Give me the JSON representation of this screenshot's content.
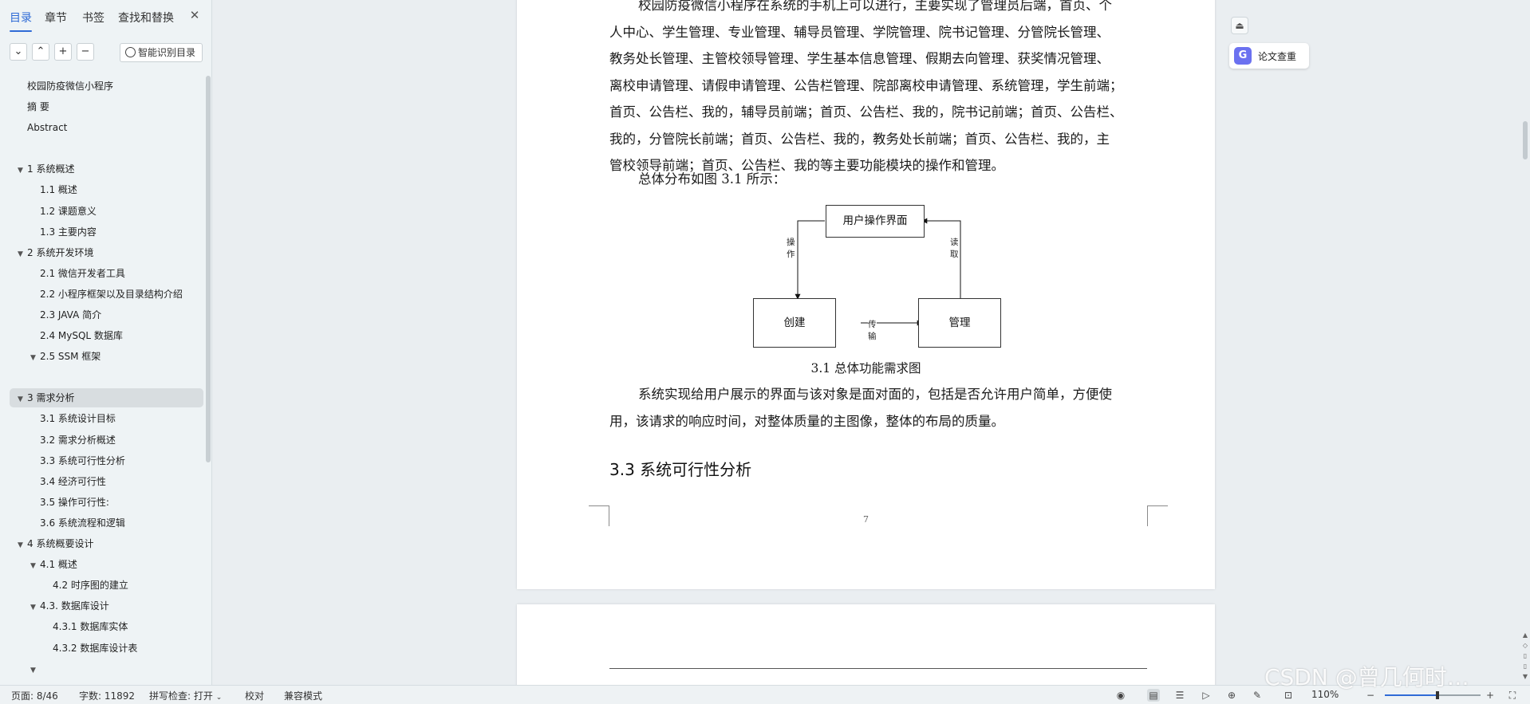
{
  "sidebar": {
    "tabs": [
      {
        "label": "目录",
        "active": true
      },
      {
        "label": "章节"
      },
      {
        "label": "书签"
      },
      {
        "label": "查找和替换"
      }
    ],
    "close_icon": "close-icon",
    "smart_toc_label": "智能识别目录",
    "toc": [
      {
        "label": "校园防疫微信小程序",
        "level": 0,
        "arrow": ""
      },
      {
        "label": "摘  要",
        "level": 0,
        "arrow": ""
      },
      {
        "label": "Abstract",
        "level": 0,
        "arrow": ""
      },
      {
        "label": "1  系统概述",
        "level": 0,
        "arrow": "▼"
      },
      {
        "label": "1.1  概述",
        "level": 1,
        "arrow": ""
      },
      {
        "label": "1.2 课题意义",
        "level": 1,
        "arrow": ""
      },
      {
        "label": "1.3  主要内容",
        "level": 1,
        "arrow": ""
      },
      {
        "label": "2  系统开发环境",
        "level": 0,
        "arrow": "▼"
      },
      {
        "label": "2.1 微信开发者工具",
        "level": 1,
        "arrow": ""
      },
      {
        "label": "2.2 小程序框架以及目录结构介绍",
        "level": 1,
        "arrow": ""
      },
      {
        "label": "2.3 JAVA 简介",
        "level": 1,
        "arrow": ""
      },
      {
        "label": "2.4 MySQL 数据库",
        "level": 1,
        "arrow": ""
      },
      {
        "label": "2.5 SSM 框架",
        "level": 1,
        "arrow": "▼"
      },
      {
        "label": "3  需求分析",
        "level": 0,
        "arrow": "▼",
        "selected": true
      },
      {
        "label": "3.1  系统设计目标",
        "level": 1,
        "arrow": ""
      },
      {
        "label": "3.2 需求分析概述",
        "level": 1,
        "arrow": ""
      },
      {
        "label": "3.3  系统可行性分析",
        "level": 1,
        "arrow": ""
      },
      {
        "label": "3.4 经济可行性",
        "level": 1,
        "arrow": ""
      },
      {
        "label": "3.5 操作可行性:",
        "level": 1,
        "arrow": ""
      },
      {
        "label": "3.6 系统流程和逻辑",
        "level": 1,
        "arrow": ""
      },
      {
        "label": "4 系统概要设计",
        "level": 0,
        "arrow": "▼"
      },
      {
        "label": "4.1  概述",
        "level": 1,
        "arrow": "▼"
      },
      {
        "label": "4.2  时序图的建立",
        "level": 2,
        "arrow": ""
      },
      {
        "label": "4.3.  数据库设计",
        "level": 1,
        "arrow": "▼"
      },
      {
        "label": "4.3.1  数据库实体",
        "level": 2,
        "arrow": ""
      },
      {
        "label": "4.3.2  数据库设计表",
        "level": 2,
        "arrow": ""
      },
      {
        "label": "",
        "level": 1,
        "arrow": "▼"
      }
    ]
  },
  "document": {
    "paragraph_lines": [
      "校园防疫微信小程序在系统的手机上可以进行，主要实现了管理员后端，首页、个",
      "人中心、学生管理、专业管理、辅导员管理、学院管理、院书记管理、分管院长管理、",
      "教务处长管理、主管校领导管理、学生基本信息管理、假期去向管理、获奖情况管理、",
      "离校申请管理、请假申请管理、公告栏管理、院部离校申请管理、系统管理，学生前端；",
      "首页、公告栏、我的，辅导员前端；首页、公告栏、我的，院书记前端；首页、公告栏、",
      "我的，分管院长前端；首页、公告栏、我的，教务处长前端；首页、公告栏、我的，主",
      "管校领导前端；首页、公告栏、我的等主要功能模块的操作和管理。"
    ],
    "figure_intro": "总体分布如图 3.1 所示：",
    "diagram": {
      "nodes": {
        "top": "用户操作界面",
        "left": "创建",
        "right": "管理"
      },
      "edges": {
        "op": "操作",
        "read": "读取",
        "transfer": "传输"
      }
    },
    "figure_caption": "3.1   总体功能需求图",
    "body_lines": [
      "系统实现给用户展示的界面与该对象是面对面的，包括是否允许用户简单，方便使",
      "用，该请求的响应时间，对整体质量的主图像，整体的布局的质量。"
    ],
    "section_heading": "3.3  系统可行性分析",
    "page_number": "7"
  },
  "right_panel": {
    "check_label": "论文查重",
    "check_icon": "G"
  },
  "statusbar": {
    "page": "页面: 8/46",
    "words": "字数: 11892",
    "spell": "拼写检查: 打开",
    "proofread": "校对",
    "compat": "兼容模式",
    "zoom": "110%",
    "zoom_fraction": 0.55
  },
  "watermark": "CSDN @曾几何时…"
}
